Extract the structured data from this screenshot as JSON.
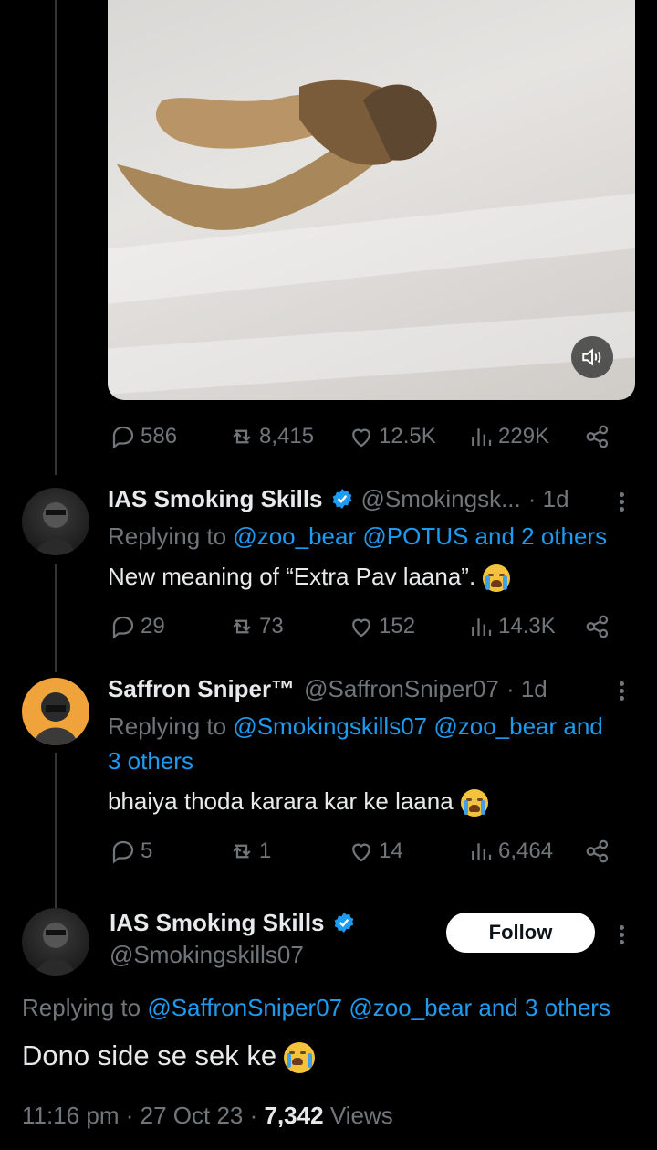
{
  "main_tweet": {
    "stats": {
      "replies": "586",
      "retweets": "8,415",
      "likes": "12.5K",
      "views": "229K"
    }
  },
  "replies": [
    {
      "name": "IAS Smoking Skills",
      "handle": "@Smokingsk...",
      "time": "· 1d",
      "replying_prefix": "Replying to",
      "replying_to": "@zoo_bear @POTUS and 2 others",
      "text": "New meaning of “Extra Pav laana”.",
      "stats": {
        "replies": "29",
        "retweets": "73",
        "likes": "152",
        "views": "14.3K"
      }
    },
    {
      "name": "Saffron Sniper™",
      "handle": "@SaffronSniper07",
      "time": "· 1d",
      "replying_prefix": "Replying to",
      "replying_to_line1": "@Smokingskills07 @zoo_bear and",
      "replying_to_line2": "3 others",
      "text": "bhaiya thoda karara kar ke laana",
      "stats": {
        "replies": "5",
        "retweets": "1",
        "likes": "14",
        "views": "6,464"
      }
    }
  ],
  "focused_tweet": {
    "name": "IAS Smoking Skills",
    "handle": "@Smokingskills07",
    "follow_label": "Follow",
    "replying_prefix": "Replying to",
    "replying_to": "@SaffronSniper07 @zoo_bear and 3 others",
    "text": "Dono side se sek ke",
    "time": "11:16 pm",
    "date": "27 Oct 23",
    "views_count": "7,342",
    "views_label": "Views"
  },
  "colors": {
    "background": "#000000",
    "text": "#e7e9ea",
    "muted": "#71767b",
    "link": "#1d9bf0",
    "verified": "#1d9bf0"
  }
}
